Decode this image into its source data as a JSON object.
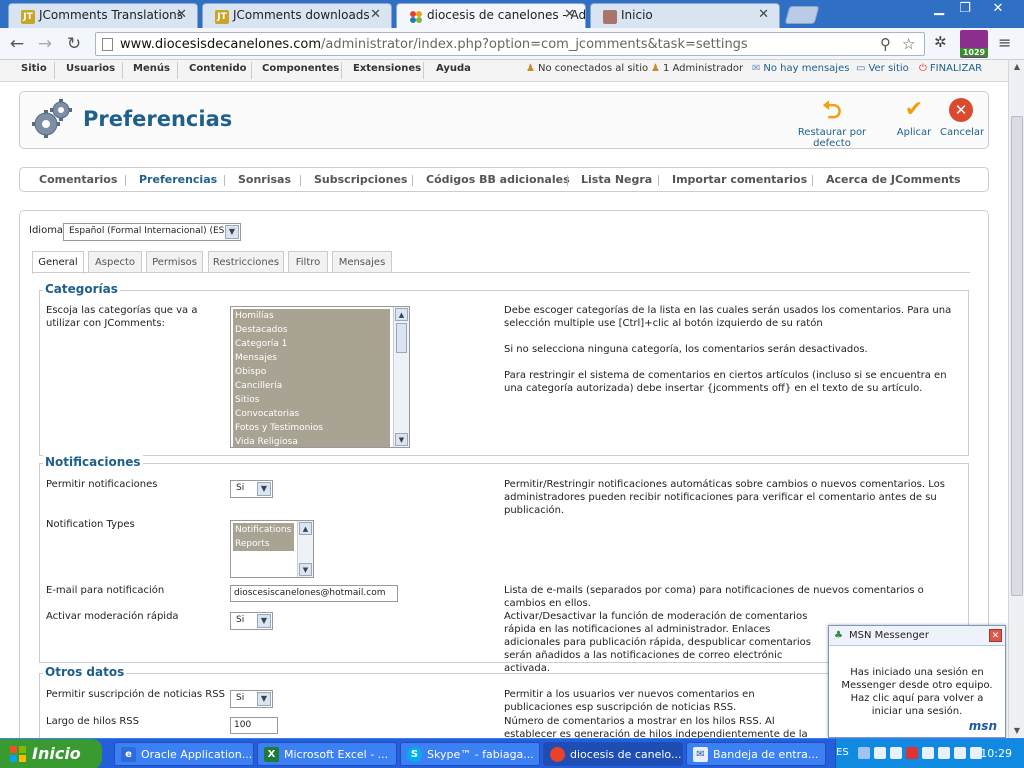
{
  "browser": {
    "tabs": [
      {
        "label": "JComments Translations",
        "icon": "jt-favicon"
      },
      {
        "label": "JComments downloads",
        "icon": "jt-favicon"
      },
      {
        "label": "diocesis de canelones - Admi",
        "icon": "joomla-favicon",
        "active": true
      },
      {
        "label": "Inicio",
        "icon": "profile-favicon"
      }
    ],
    "tab_close": "✕",
    "url_host": "www.diocesisdecanelones.com",
    "url_path": "/administrator/index.php?option=com_jcomments&task=settings",
    "badge_count": "1029"
  },
  "admin_menu": {
    "items": [
      "Sitio",
      "Usuarios",
      "Menús",
      "Contenido",
      "Componentes",
      "Extensiones",
      "Ayuda"
    ],
    "status": {
      "offline": "No conectados al sitio",
      "admins": "1 Administrador",
      "messages": "No hay mensajes",
      "view_site": "Ver sitio",
      "logout": "FINALIZAR"
    }
  },
  "toolbar": {
    "title": "Preferencias",
    "restore_label": "Restaurar por defecto",
    "apply_label": "Aplicar",
    "cancel_label": "Cancelar"
  },
  "submenu": {
    "items": [
      "Comentarios",
      "Preferencias",
      "Sonrisas",
      "Subscripciones",
      "Códigos BB adicionales",
      "Lista Negra",
      "Importar comentarios",
      "Acerca de JComments"
    ],
    "active_index": 1
  },
  "settings": {
    "language_label": "Idioma",
    "language_value": "Español (Formal Internacional) (ES)",
    "tabs": [
      "General",
      "Aspecto",
      "Permisos",
      "Restricciones",
      "Filtro",
      "Mensajes"
    ],
    "active_tab": 0,
    "categories": {
      "legend": "Categorías",
      "label": "Escoja las categorías que va a utilizar con JComments:",
      "options": [
        "Homilías",
        "Destacados",
        "Categoría 1",
        "Mensajes",
        "Obispo",
        "Cancillería",
        "Sitios",
        "Convocatorias",
        "Fotos y Testimonios",
        "Vida Religiosa"
      ],
      "desc1": "Debe escoger categorías de la lista en las cuales serán usados los comentarios. Para una selección multiple use [Ctrl]+clic al botón izquierdo de su ratón",
      "desc2": "Si no selecciona ninguna categoría, los comentarios serán desactivados.",
      "desc3": "Para restringir el sistema de comentarios en ciertos artículos (incluso si se encuentra en una categoría autorizada) debe insertar {jcomments off} en el texto de su artículo."
    },
    "notifications": {
      "legend": "Notificaciones",
      "allow_label": "Permitir notificaciones",
      "allow_value": "Si",
      "allow_desc": "Permitir/Restringir notificaciones automáticas sobre cambios o nuevos comentarios. Los administradores pueden recibir notificaciones para verificar el comentario antes de su publicación.",
      "types_label": "Notification Types",
      "types_options": [
        "Notifications",
        "Reports"
      ],
      "email_label": "E-mail para notificación",
      "email_value": "dioscesiscanelones@hotmail.com",
      "email_desc": "Lista de e-mails (separados por coma) para notificaciones de nuevos comentarios o cambios en ellos.",
      "quick_label": "Activar moderación rápida",
      "quick_value": "Si",
      "quick_desc": "Activar/Desactivar la función de moderación de comentarios rápida en las notificaciones al administrador. Enlaces adicionales para publicación rápida, despublicar comentarios serán añadidos a las notificaciones de correo electrónic activada."
    },
    "other": {
      "legend": "Otros datos",
      "rss_label": "Permitir suscripción de noticias RSS",
      "rss_value": "Si",
      "rss_desc": "Permitir a los usuarios ver nuevos comentarios en publicaciones esp suscripción de noticias RSS.",
      "length_label": "Largo de hilos RSS",
      "length_value": "100",
      "length_desc": "Número de comentarios a mostrar en los hilos RSS. Al establecer es generación de hilos independientemente de la opción \"e;Permitir Hil"
    }
  },
  "msn": {
    "title": "MSN Messenger",
    "message": "Has iniciado una sesión en Messenger desde otro equipo. Haz clic aquí para volver a iniciar una sesión.",
    "logo": "msn"
  },
  "taskbar": {
    "start": "Inicio",
    "tasks": [
      "Oracle Application...",
      "Microsoft Excel - ...",
      "Skype™ - fabiaga...",
      "diocesis de canelo...",
      "Bandeja de entra..."
    ],
    "lang": "ES",
    "clock": "10:29"
  },
  "colors": {
    "accent": "#1e5f8c",
    "listbox_selected": "#a9a394",
    "apply": "#f0a010",
    "cancel": "#d94a2e",
    "restore": "#f0a010"
  }
}
